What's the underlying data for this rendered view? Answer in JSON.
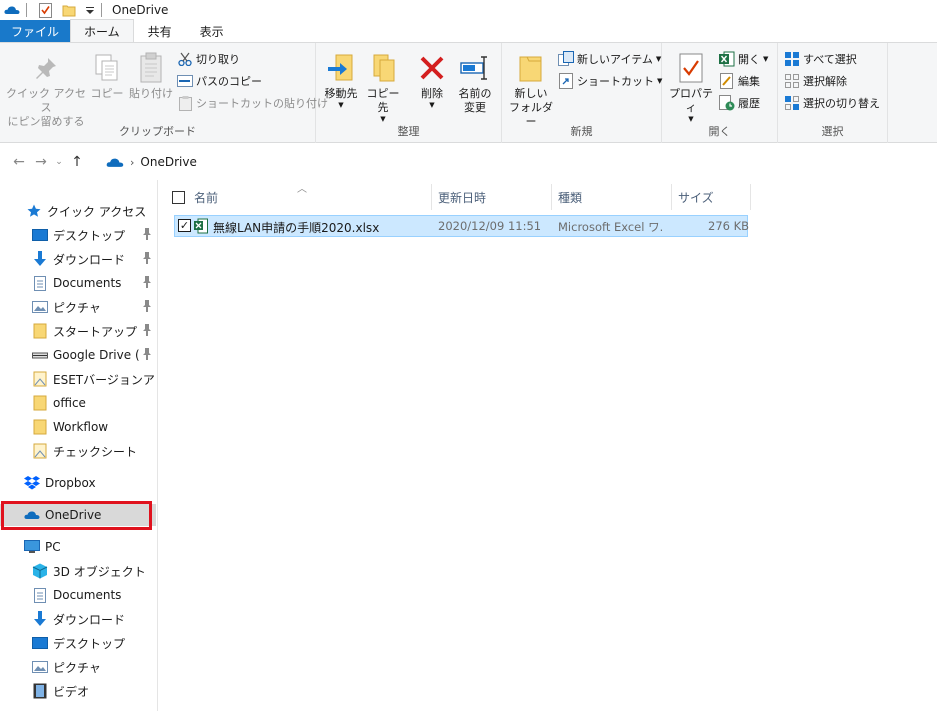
{
  "window": {
    "title": "OneDrive"
  },
  "tabs": {
    "file": "ファイル",
    "home": "ホーム",
    "share": "共有",
    "view": "表示"
  },
  "ribbon": {
    "clipboard": {
      "label": "クリップボード",
      "pin_line1": "クイック アクセス",
      "pin_line2": "にピン留めする",
      "copy": "コピー",
      "paste": "貼り付け",
      "cut": "切り取り",
      "copy_path": "パスのコピー",
      "paste_shortcut": "ショートカットの貼り付け"
    },
    "organize": {
      "label": "整理",
      "move_to": "移動先",
      "copy_to": "コピー先",
      "delete": "削除",
      "rename_line1": "名前の",
      "rename_line2": "変更"
    },
    "new": {
      "label": "新規",
      "new_folder_line1": "新しい",
      "new_folder_line2": "フォルダー",
      "new_item": "新しいアイテム",
      "shortcut": "ショートカット"
    },
    "open": {
      "label": "開く",
      "properties": "プロパティ",
      "open": "開く",
      "edit": "編集",
      "history": "履歴"
    },
    "select": {
      "label": "選択",
      "select_all": "すべて選択",
      "select_none": "選択解除",
      "invert": "選択の切り替え"
    }
  },
  "address": {
    "path": "OneDrive"
  },
  "nav": {
    "quick_access": "クイック アクセス",
    "qa_items": [
      "デスクトップ",
      "ダウンロード",
      "Documents",
      "ピクチャ",
      "スタートアップ",
      "Google Drive (G:",
      "ESETバージョンアップ",
      "office",
      "Workflow",
      "チェックシート"
    ],
    "dropbox": "Dropbox",
    "onedrive": "OneDrive",
    "pc": "PC",
    "pc_items": [
      "3D オブジェクト",
      "Documents",
      "ダウンロード",
      "デスクトップ",
      "ピクチャ",
      "ビデオ"
    ]
  },
  "list": {
    "headers": {
      "name": "名前",
      "modified": "更新日時",
      "type": "種類",
      "size": "サイズ"
    },
    "files": [
      {
        "name": "無線LAN申請の手順2020.xlsx",
        "modified": "2020/12/09 11:51",
        "type": "Microsoft Excel ワ...",
        "size": "276 KB"
      }
    ]
  },
  "colors": {
    "accent": "#1979ca",
    "selection": "#cce8ff",
    "highlight": "#e0121e",
    "excel": "#1d7044"
  }
}
